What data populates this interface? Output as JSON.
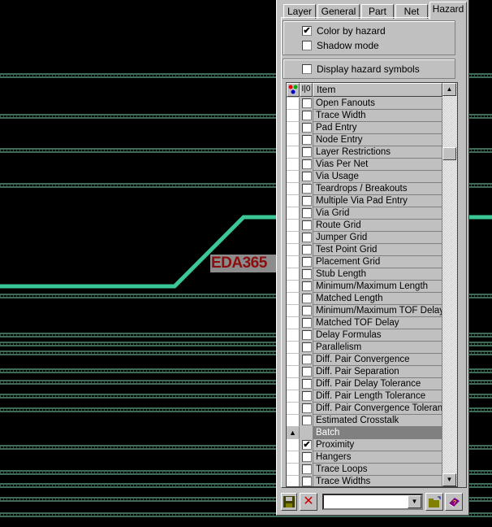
{
  "watermark": "EDA365",
  "colors": {
    "trace": "#3cc896",
    "bus": "#7fd4b0",
    "watermark_text": "#8b0d0d"
  },
  "tabs": [
    {
      "label": "Layer",
      "active": false
    },
    {
      "label": "General",
      "active": false
    },
    {
      "label": "Part",
      "active": false
    },
    {
      "label": "Net",
      "active": false
    },
    {
      "label": "Hazard",
      "active": true
    }
  ],
  "options": {
    "color_by_hazard": {
      "label": "Color by hazard",
      "checked": true
    },
    "shadow_mode": {
      "label": "Shadow mode",
      "checked": false
    },
    "display_hazard_symbols": {
      "label": "Display hazard symbols",
      "checked": false
    }
  },
  "list": {
    "header": {
      "col2": "I|0",
      "item": "Item"
    },
    "items": [
      {
        "label": "Open Fanouts",
        "checked": false
      },
      {
        "label": "Trace Width",
        "checked": false
      },
      {
        "label": "Pad Entry",
        "checked": false
      },
      {
        "label": "Node Entry",
        "checked": false
      },
      {
        "label": "Layer Restrictions",
        "checked": false
      },
      {
        "label": "Vias Per Net",
        "checked": false
      },
      {
        "label": "Via Usage",
        "checked": false
      },
      {
        "label": "Teardrops / Breakouts",
        "checked": false
      },
      {
        "label": "Multiple Via Pad Entry",
        "checked": false
      },
      {
        "label": "Via Grid",
        "checked": false
      },
      {
        "label": "Route Grid",
        "checked": false
      },
      {
        "label": "Jumper Grid",
        "checked": false
      },
      {
        "label": "Test Point Grid",
        "checked": false
      },
      {
        "label": "Placement Grid",
        "checked": false
      },
      {
        "label": "Stub Length",
        "checked": false
      },
      {
        "label": "Minimum/Maximum Length",
        "checked": false
      },
      {
        "label": "Matched Length",
        "checked": false
      },
      {
        "label": "Minimum/Maximum TOF Delay",
        "checked": false
      },
      {
        "label": "Matched TOF Delay",
        "checked": false
      },
      {
        "label": "Delay Formulas",
        "checked": false
      },
      {
        "label": "Parallelism",
        "checked": false
      },
      {
        "label": "Diff. Pair Convergence",
        "checked": false
      },
      {
        "label": "Diff. Pair Separation",
        "checked": false
      },
      {
        "label": "Diff. Pair Delay Tolerance",
        "checked": false
      },
      {
        "label": "Diff. Pair Length Tolerance",
        "checked": false
      },
      {
        "label": "Diff. Pair Convergence Toleran...",
        "checked": false
      },
      {
        "label": "Estimated Crosstalk",
        "checked": false
      },
      {
        "label": "Batch",
        "group": true
      },
      {
        "label": "Proximity",
        "checked": true
      },
      {
        "label": "Hangers",
        "checked": false
      },
      {
        "label": "Trace Loops",
        "checked": false
      },
      {
        "label": "Trace Widths",
        "checked": false
      }
    ]
  },
  "toolbar": {
    "combo_value": ""
  }
}
